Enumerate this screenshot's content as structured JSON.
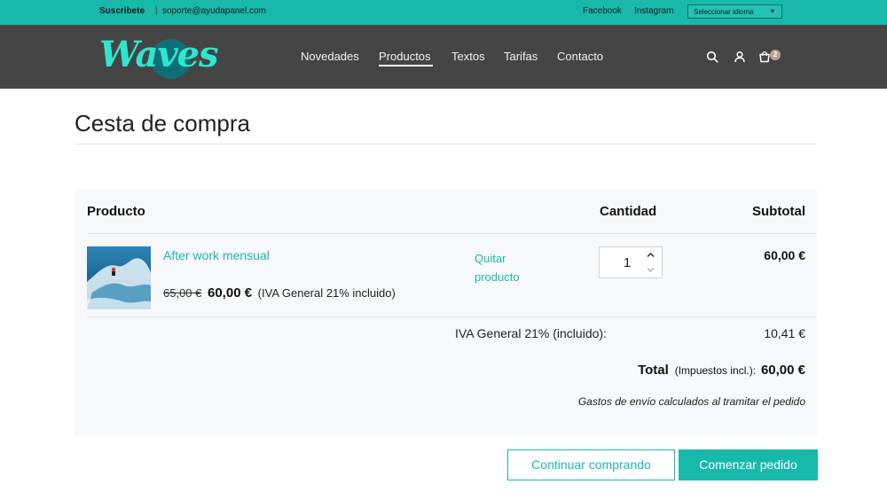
{
  "topbar": {
    "subscribe": "Suscribete",
    "separator": "|",
    "email": "soporte@ayudapanel.com",
    "facebook": "Facebook",
    "instagram": "Instagram",
    "language_select": "Seleccionar idioma",
    "language_caret": "▾"
  },
  "header": {
    "logo_text": "Waves",
    "nav": [
      "Novedades",
      "Productos",
      "Textos",
      "Tarifas",
      "Contacto"
    ],
    "active_nav": "Productos",
    "icons": [
      "search-icon",
      "user-icon",
      "cart-icon"
    ],
    "cart_count": "2"
  },
  "page": {
    "title": "Cesta de compra"
  },
  "cart": {
    "columns": {
      "product": "Producto",
      "quantity": "Cantidad",
      "subtotal": "Subtotal"
    },
    "items": [
      {
        "name": "After work mensual",
        "old_price": "65,00 €",
        "price": "60,00 €",
        "tax_note": "(IVA General 21% incluido)",
        "remove_label": "Quitar producto",
        "quantity": "1",
        "subtotal": "60,00 €"
      }
    ],
    "tax_label": "IVA General 21% (incluido):",
    "tax_value": "10,41 €",
    "total_label": "Total",
    "total_note": "(Impuestos incl.):",
    "total_value": "60,00 €",
    "shipping_note": "Gastos de envío calculados al tramitar el pedido"
  },
  "actions": {
    "continue_label": "Continuar comprando",
    "checkout_label": "Comenzar pedido"
  },
  "colors": {
    "accent": "#18b9ab",
    "header_bg": "#454545",
    "panel_bg": "#f7f8f9",
    "logo": "#2ee6cf"
  }
}
